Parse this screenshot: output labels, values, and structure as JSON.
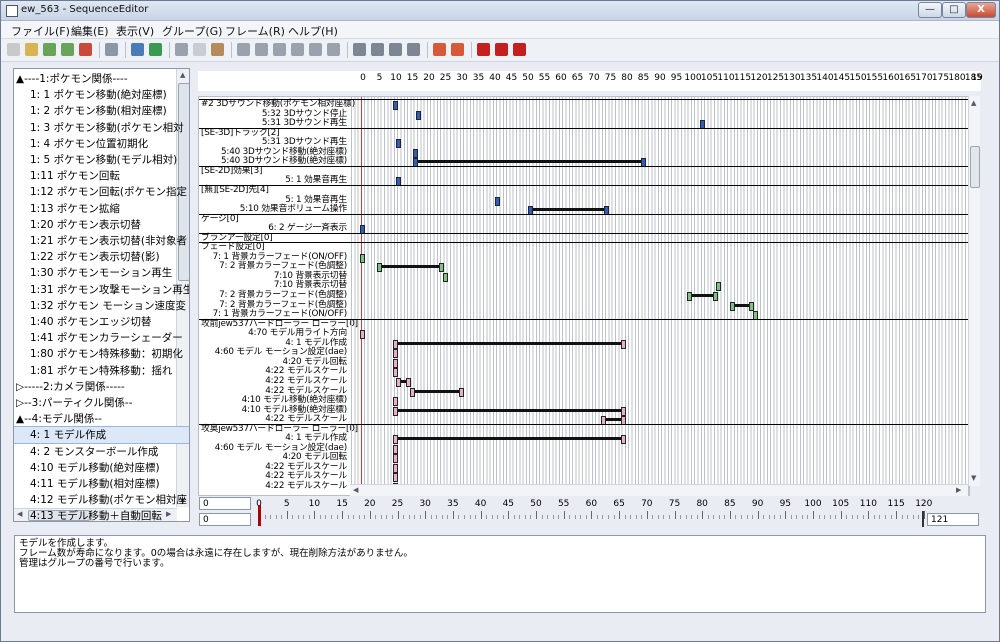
{
  "window": {
    "title": "ew_563 - SequenceEditor",
    "controls": [
      "—",
      "□",
      "X"
    ]
  },
  "menu": [
    "ファイル(F)",
    "編集(E)",
    "表示(V)",
    "グループ(G)",
    "フレーム(R)",
    "ヘルプ(H)"
  ],
  "toolbar": {
    "icons": [
      {
        "name": "new-file-icon",
        "color": "#c9c9c9"
      },
      {
        "name": "open-folder-icon",
        "color": "#d7b454"
      },
      {
        "name": "save-up-icon",
        "color": "#6aa35a"
      },
      {
        "name": "save-down-icon",
        "color": "#6aa35a"
      },
      {
        "name": "exit-icon",
        "color": "#c94a3a"
      },
      {
        "name": "car-icon",
        "color": "#8c97a5"
      },
      {
        "name": "undo-icon",
        "color": "#4b7bb7"
      },
      {
        "name": "redo-icon",
        "color": "#3a9a4f"
      },
      {
        "name": "cut-icon",
        "color": "#9aa3ad"
      },
      {
        "name": "copy-icon",
        "color": "#c9cdd3"
      },
      {
        "name": "paste-icon",
        "color": "#b58a5c"
      },
      {
        "name": "align-left-icon",
        "color": "#9aa3ad"
      },
      {
        "name": "align-center-icon",
        "color": "#9aa3ad"
      },
      {
        "name": "align-right-icon",
        "color": "#9aa3ad"
      },
      {
        "name": "indent-icon",
        "color": "#9aa3ad"
      },
      {
        "name": "outdent-icon",
        "color": "#9aa3ad"
      },
      {
        "name": "justify-icon",
        "color": "#9aa3ad"
      },
      {
        "name": "frame-left-icon",
        "color": "#7d8794"
      },
      {
        "name": "frame-mid-icon",
        "color": "#7d8794"
      },
      {
        "name": "frame-down-icon",
        "color": "#7d8794"
      },
      {
        "name": "frame-right-icon",
        "color": "#7d8794"
      },
      {
        "name": "key-add-icon",
        "color": "#d65a3a"
      },
      {
        "name": "key-remove-icon",
        "color": "#d65a3a"
      },
      {
        "name": "record-stop-icon",
        "color": "#c42020"
      },
      {
        "name": "record-icon",
        "color": "#c42020"
      },
      {
        "name": "record-end-icon",
        "color": "#c42020"
      }
    ]
  },
  "tree": {
    "items": [
      {
        "label": "▲----1:ポケモン関係----",
        "indent": 0
      },
      {
        "label": "1: 1 ポケモン移動(絶対座標)",
        "indent": 1
      },
      {
        "label": "1: 2 ポケモン移動(相対座標)",
        "indent": 1
      },
      {
        "label": "1: 3 ポケモン移動(ポケモン相対",
        "indent": 1
      },
      {
        "label": "1: 4 ポケモン位置初期化",
        "indent": 1
      },
      {
        "label": "1: 5 ポケモン移動(モデル相対)",
        "indent": 1
      },
      {
        "label": "1:11 ポケモン回転",
        "indent": 1
      },
      {
        "label": "1:12 ポケモン回転(ポケモン指定",
        "indent": 1
      },
      {
        "label": "1:13 ポケモン拡縮",
        "indent": 1
      },
      {
        "label": "1:20 ポケモン表示切替",
        "indent": 1
      },
      {
        "label": "1:21 ポケモン表示切替(非対象者",
        "indent": 1
      },
      {
        "label": "1:22 ポケモン表示切替(影)",
        "indent": 1
      },
      {
        "label": "1:30 ポケモンモーション再生",
        "indent": 1
      },
      {
        "label": "1:31 ポケモン攻撃モーション再生",
        "indent": 1
      },
      {
        "label": "1:32 ポケモン モーション速度変",
        "indent": 1
      },
      {
        "label": "1:40 ポケモンエッジ切替",
        "indent": 1
      },
      {
        "label": "1:41 ポケモンカラーシェーダー",
        "indent": 1
      },
      {
        "label": "1:80 ポケモン特殊移動：初期化",
        "indent": 1
      },
      {
        "label": "1:81 ポケモン特殊移動：揺れ",
        "indent": 1
      },
      {
        "label": "▷-----2:カメラ関係-----",
        "indent": 0
      },
      {
        "label": "▷--3:パーティクル関係--",
        "indent": 0
      },
      {
        "label": "▲--4:モデル関係--",
        "indent": 0
      },
      {
        "label": "4: 1 モデル作成",
        "indent": 1,
        "selected": true
      },
      {
        "label": "4: 2 モンスターボール作成",
        "indent": 1
      },
      {
        "label": "4:10 モデル移動(絶対座標)",
        "indent": 1
      },
      {
        "label": "4:11 モデル移動(相対座標)",
        "indent": 1
      },
      {
        "label": "4:12 モデル移動(ポケモン相対座",
        "indent": 1
      },
      {
        "label": "4:13 モデル移動＋自動回転",
        "indent": 1
      }
    ]
  },
  "ruler": {
    "ticks": [
      "0",
      "5",
      "10",
      "15",
      "20",
      "25",
      "30",
      "35",
      "40",
      "45",
      "50",
      "55",
      "60",
      "65",
      "70",
      "75",
      "80",
      "85",
      "90",
      "95",
      "100",
      "105",
      "110",
      "115",
      "120",
      "125",
      "130",
      "135",
      "140",
      "145",
      "150",
      "155",
      "160",
      "165",
      "170",
      "175",
      "180",
      "185",
      "19"
    ]
  },
  "timeline": {
    "colors": {
      "blue": "#2f5fb0",
      "green": "#7fc27a",
      "pink": "#e8b3b8",
      "red": "#d33333"
    },
    "rows": [
      {
        "label": "#2 3Dサウンド移動(ポケモン相対座標)",
        "group": true,
        "line_before": true,
        "marks": [
          {
            "f": 10,
            "c": "blue"
          }
        ]
      },
      {
        "label": "5:32 3Dサウンド停止",
        "marks": [
          {
            "f": 17,
            "c": "blue"
          }
        ]
      },
      {
        "label": "5:31 3Dサウンド再生",
        "marks": [
          {
            "f": 103,
            "c": "blue"
          }
        ]
      },
      {
        "label": "[SE-3D]トラック[2]",
        "group": true,
        "line_before": true,
        "marks": []
      },
      {
        "label": "5:31 3Dサウンド再生",
        "marks": [
          {
            "f": 11,
            "c": "blue"
          }
        ]
      },
      {
        "label": "5:40 3Dサウンド移動(絶対座標)",
        "marks": [
          {
            "f": 16,
            "c": "blue"
          }
        ]
      },
      {
        "label": "5:40 3Dサウンド移動(絶対座標)",
        "marks": [
          {
            "f": 16,
            "c": "blue"
          },
          {
            "f": 85,
            "c": "blue"
          }
        ],
        "bars": [
          [
            16,
            85
          ]
        ]
      },
      {
        "label": "[SE-2D]効果[3]",
        "group": true,
        "line_before": true,
        "marks": []
      },
      {
        "label": "5: 1 効果音再生",
        "marks": [
          {
            "f": 11,
            "c": "blue"
          }
        ]
      },
      {
        "label": "[無][SE-2D]先[4]",
        "group": true,
        "line_before": true,
        "marks": []
      },
      {
        "label": "5: 1 効果音再生",
        "marks": [
          {
            "f": 41,
            "c": "blue"
          }
        ]
      },
      {
        "label": "5:10 効果音ボリューム操作",
        "marks": [
          {
            "f": 51,
            "c": "blue"
          },
          {
            "f": 74,
            "c": "blue"
          }
        ],
        "bars": [
          [
            51,
            74
          ]
        ]
      },
      {
        "label": "ゲージ[0]",
        "group": true,
        "line_before": true,
        "marks": []
      },
      {
        "label": "6: 2 ゲージ一斉表示",
        "marks": [
          {
            "f": 0,
            "c": "blue"
          }
        ]
      },
      {
        "label": "ブランアー設定[0]",
        "group": true,
        "line_before": true,
        "marks": []
      },
      {
        "label": "フェード設定[0]",
        "group": true,
        "line_before": true,
        "marks": []
      },
      {
        "label": "7: 1 背景カラーフェード(ON/OFF)",
        "marks": [
          {
            "f": 0,
            "c": "green"
          }
        ]
      },
      {
        "label": "7: 2 背景カラーフェード(色調整)",
        "marks": [
          {
            "f": 5,
            "c": "green"
          },
          {
            "f": 24,
            "c": "green"
          }
        ],
        "bars": [
          [
            5,
            24
          ]
        ]
      },
      {
        "label": "7:10 背景表示切替",
        "marks": [
          {
            "f": 25,
            "c": "green"
          }
        ]
      },
      {
        "label": "7:10 背景表示切替",
        "marks": [
          {
            "f": 108,
            "c": "green"
          }
        ]
      },
      {
        "label": "7: 2 背景カラーフェード(色調整)",
        "marks": [
          {
            "f": 99,
            "c": "green"
          },
          {
            "f": 107,
            "c": "green"
          }
        ],
        "bars": [
          [
            99,
            107
          ]
        ]
      },
      {
        "label": "7: 2 背景カラーフェード(色調整)",
        "marks": [
          {
            "f": 112,
            "c": "green"
          },
          {
            "f": 118,
            "c": "green"
          }
        ],
        "bars": [
          [
            112,
            118
          ]
        ]
      },
      {
        "label": "7: 1 背景カラーフェード(ON/OFF)",
        "marks": [
          {
            "f": 119,
            "c": "green"
          }
        ]
      },
      {
        "label": "攻前jew537ハードローラー ローラー[0]",
        "group": true,
        "line_before": true,
        "marks": []
      },
      {
        "label": "4:70 モデル用ライト方向",
        "marks": [
          {
            "f": 0,
            "c": "pink"
          }
        ]
      },
      {
        "label": "4: 1 モデル作成",
        "marks": [
          {
            "f": 10,
            "c": "pink"
          },
          {
            "f": 79,
            "c": "pink"
          }
        ],
        "bars": [
          [
            10,
            79
          ]
        ]
      },
      {
        "label": "4:60 モデル モーション設定(dae)",
        "marks": [
          {
            "f": 10,
            "c": "pink"
          }
        ]
      },
      {
        "label": "4:20 モデル回転",
        "marks": [
          {
            "f": 10,
            "c": "pink"
          }
        ]
      },
      {
        "label": "4:22 モデルスケール",
        "marks": [
          {
            "f": 10,
            "c": "pink"
          }
        ]
      },
      {
        "label": "4:22 モデルスケール",
        "marks": [
          {
            "f": 11,
            "c": "pink"
          },
          {
            "f": 14,
            "c": "pink"
          }
        ],
        "bars": [
          [
            11,
            14
          ]
        ]
      },
      {
        "label": "4:22 モデルスケール",
        "marks": [
          {
            "f": 15,
            "c": "pink"
          },
          {
            "f": 30,
            "c": "pink"
          }
        ],
        "bars": [
          [
            15,
            30
          ]
        ]
      },
      {
        "label": "4:10 モデル移動(絶対座標)",
        "marks": [
          {
            "f": 10,
            "c": "pink"
          }
        ]
      },
      {
        "label": "4:10 モデル移動(絶対座標)",
        "marks": [
          {
            "f": 10,
            "c": "pink"
          },
          {
            "f": 79,
            "c": "pink"
          }
        ],
        "bars": [
          [
            10,
            79
          ]
        ]
      },
      {
        "label": "4:22 モデルスケール",
        "marks": [
          {
            "f": 73,
            "c": "pink"
          },
          {
            "f": 79,
            "c": "pink"
          }
        ],
        "bars": [
          [
            73,
            79
          ]
        ]
      },
      {
        "label": "攻奥jew537ハードローラー ローラー[0]",
        "group": true,
        "line_before": true,
        "marks": []
      },
      {
        "label": "4: 1 モデル作成",
        "marks": [
          {
            "f": 10,
            "c": "pink"
          },
          {
            "f": 79,
            "c": "pink"
          }
        ],
        "bars": [
          [
            10,
            79
          ]
        ]
      },
      {
        "label": "4:60 モデル モーション設定(dae)",
        "marks": [
          {
            "f": 10,
            "c": "pink"
          }
        ]
      },
      {
        "label": "4:20 モデル回転",
        "marks": [
          {
            "f": 10,
            "c": "pink"
          }
        ]
      },
      {
        "label": "4:22 モデルスケール",
        "marks": [
          {
            "f": 10,
            "c": "pink"
          }
        ]
      },
      {
        "label": "4:22 モデルスケール",
        "marks": [
          {
            "f": 10,
            "c": "pink"
          }
        ]
      },
      {
        "label": "4:22 モデルスケール",
        "marks": [
          {
            "f": 10,
            "c": "pink"
          }
        ]
      }
    ]
  },
  "bottom": {
    "spin_start": "0",
    "spin_current": "0",
    "spin_end": "121",
    "ticks": [
      "0",
      "5",
      "10",
      "15",
      "20",
      "25",
      "30",
      "35",
      "40",
      "45",
      "50",
      "55",
      "60",
      "65",
      "70",
      "75",
      "80",
      "85",
      "90",
      "95",
      "100",
      "105",
      "110",
      "115",
      "120"
    ]
  },
  "description": [
    "モデルを作成します。",
    "フレーム数が寿命になります。0の場合は永遠に存在しますが、現在削除方法がありません。",
    "管理はグループの番号で行います。"
  ]
}
